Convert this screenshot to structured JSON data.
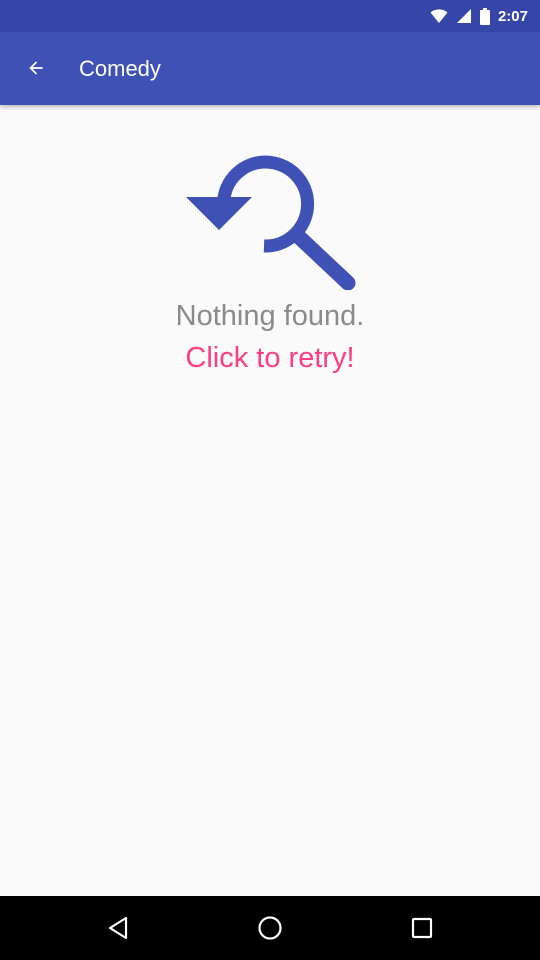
{
  "status_bar": {
    "time": "2:07",
    "icons": [
      "wifi-icon",
      "cell-signal-icon",
      "battery-icon"
    ]
  },
  "app_bar": {
    "title": "Comedy",
    "back_icon": "arrow-back-icon",
    "color": "#3f51b5"
  },
  "empty_state": {
    "icon": "search-refresh-icon",
    "message": "Nothing found.",
    "retry_label": "Click to retry!",
    "icon_color": "#3f51b5",
    "retry_color": "#ff3d7f"
  },
  "nav_bar": {
    "buttons": [
      "back-triangle-icon",
      "home-circle-icon",
      "recents-square-icon"
    ]
  }
}
